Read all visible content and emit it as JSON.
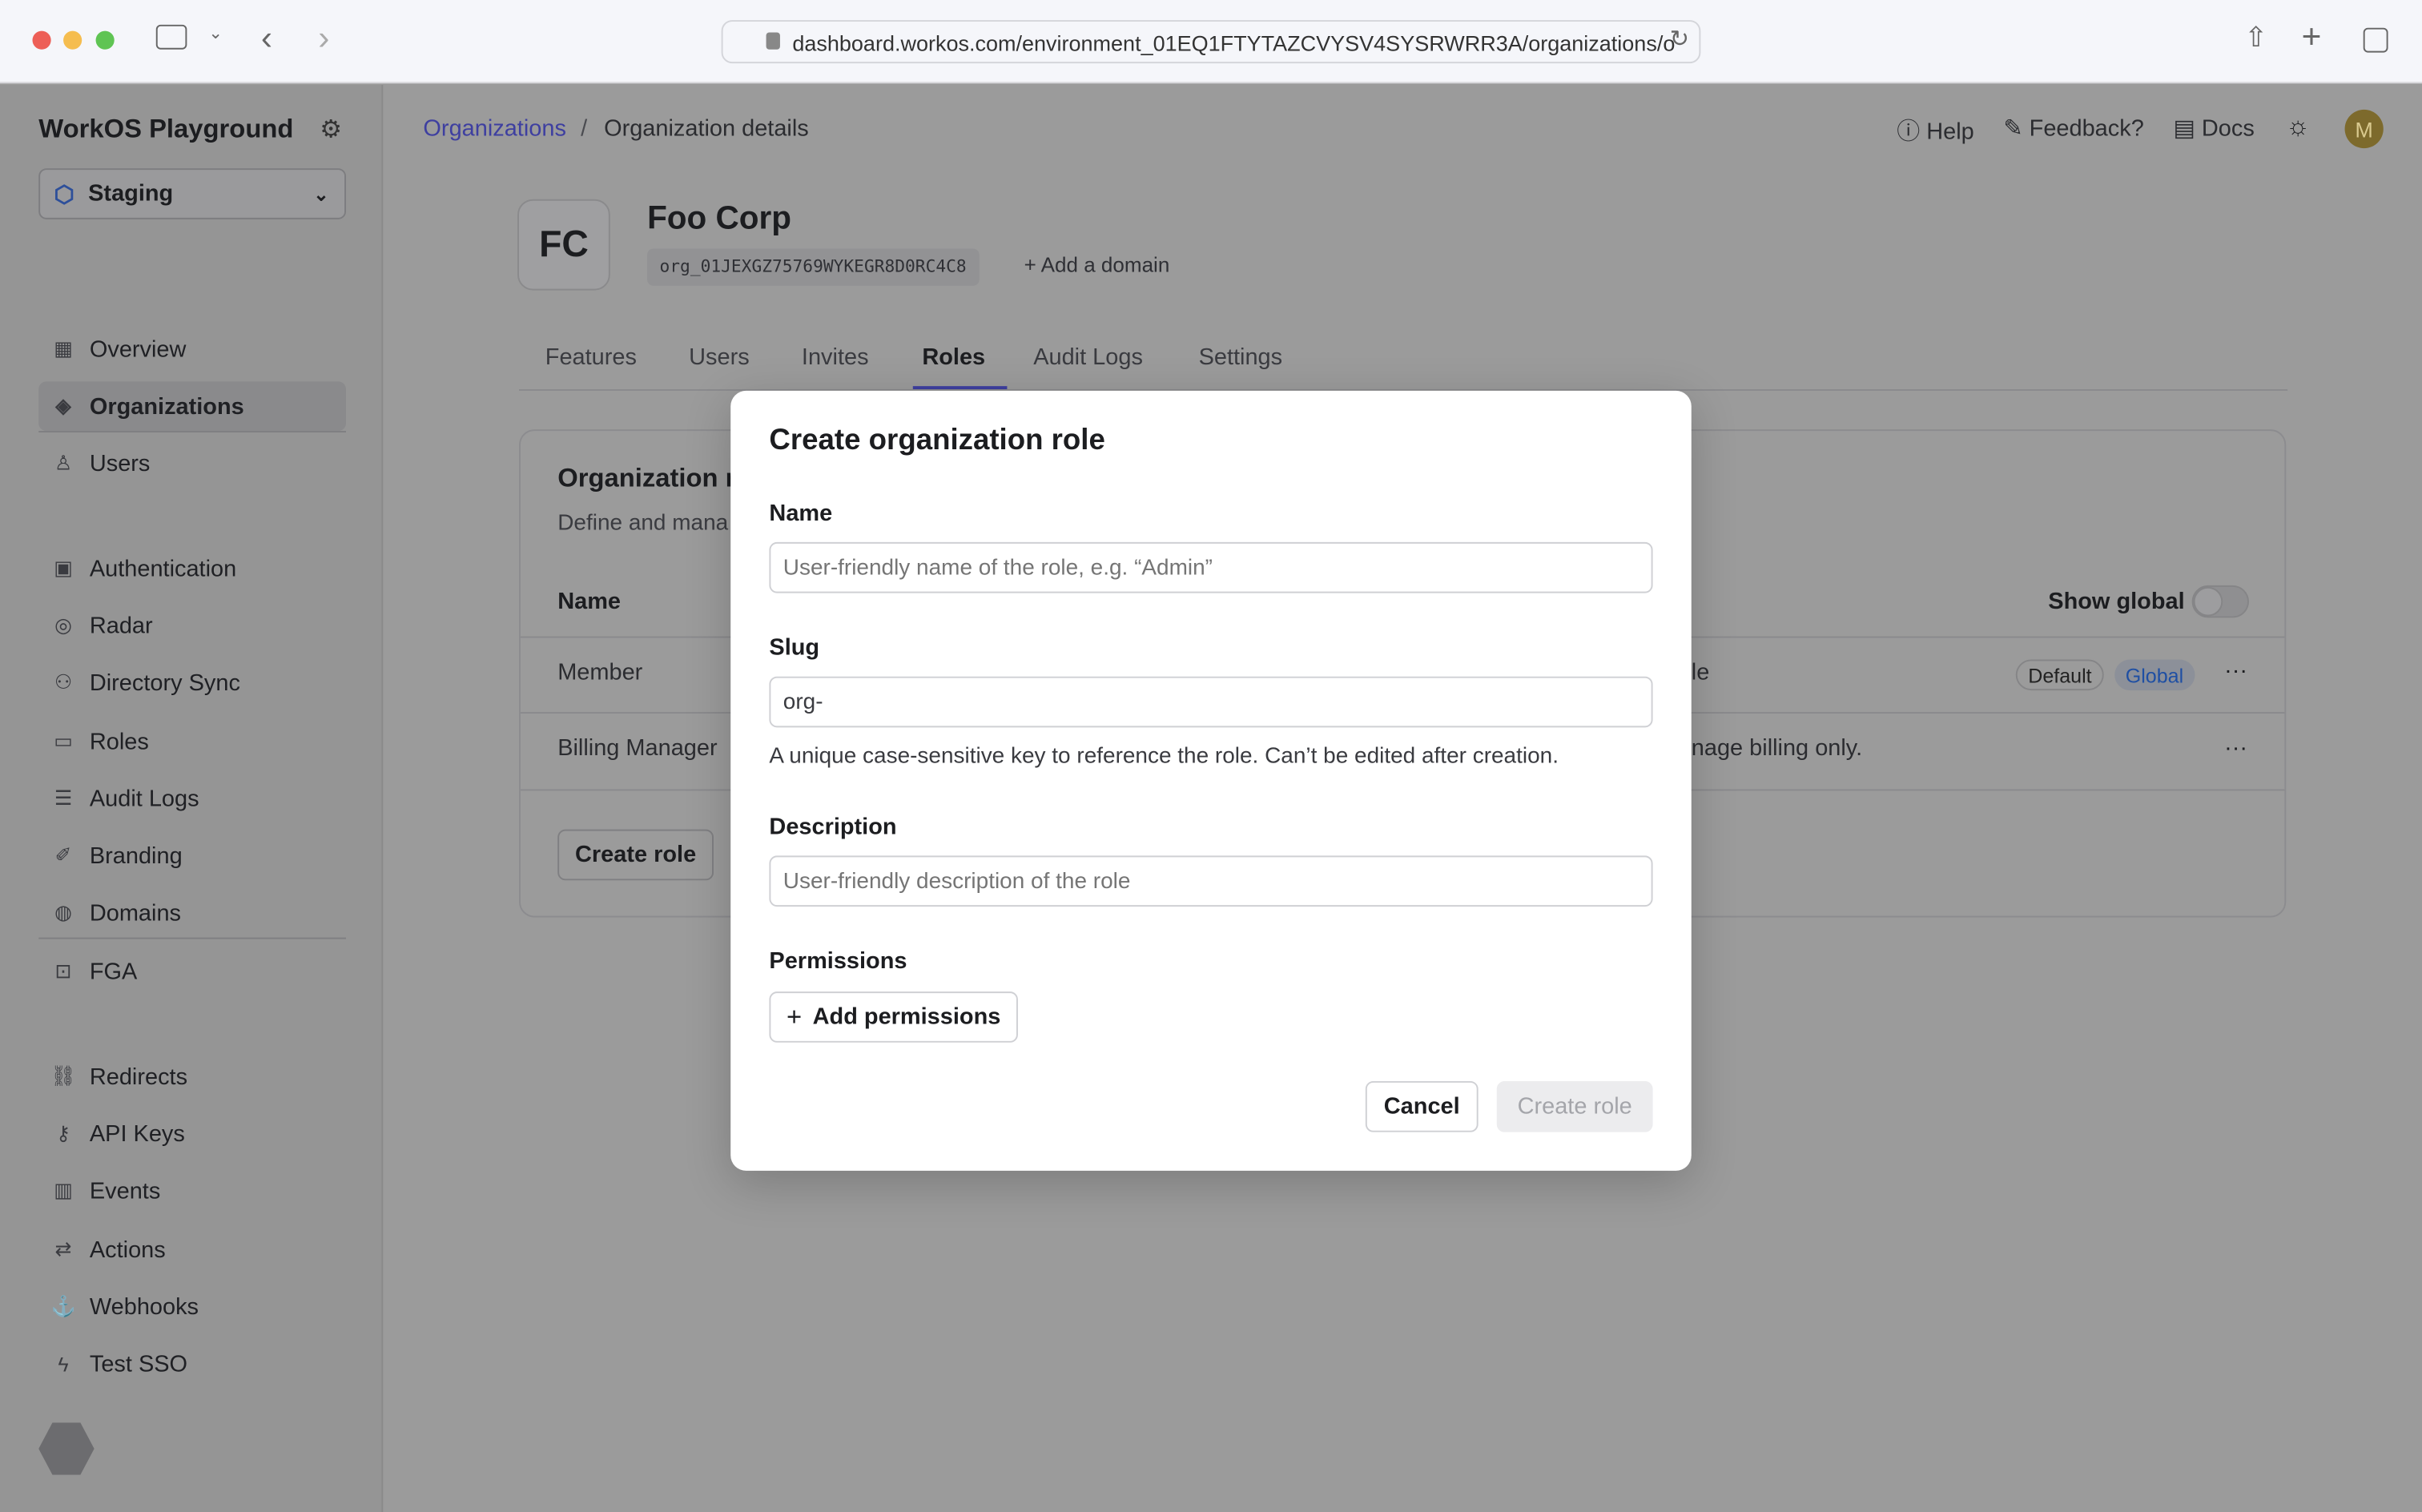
{
  "browser": {
    "url": "dashboard.workos.com/environment_01EQ1FTYTAZCVYSV4SYSRWRR3A/organizations/o"
  },
  "sidebar": {
    "app_title": "WorkOS Playground",
    "environment": "Staging",
    "items": [
      {
        "label": "Overview",
        "icon": "grid-icon"
      },
      {
        "label": "Organizations",
        "icon": "layers-icon"
      },
      {
        "label": "Users",
        "icon": "user-icon"
      },
      {
        "label": "Authentication",
        "icon": "auth-icon"
      },
      {
        "label": "Radar",
        "icon": "radar-icon"
      },
      {
        "label": "Directory Sync",
        "icon": "users-icon"
      },
      {
        "label": "Roles",
        "icon": "id-card-icon"
      },
      {
        "label": "Audit Logs",
        "icon": "audit-icon"
      },
      {
        "label": "Branding",
        "icon": "brush-icon"
      },
      {
        "label": "Domains",
        "icon": "globe-icon"
      },
      {
        "label": "FGA",
        "icon": "fga-icon"
      },
      {
        "label": "Redirects",
        "icon": "link-icon"
      },
      {
        "label": "API Keys",
        "icon": "key-icon"
      },
      {
        "label": "Events",
        "icon": "events-icon"
      },
      {
        "label": "Actions",
        "icon": "actions-icon"
      },
      {
        "label": "Webhooks",
        "icon": "webhook-icon"
      },
      {
        "label": "Test SSO",
        "icon": "bolt-icon"
      }
    ]
  },
  "header": {
    "breadcrumb_root": "Organizations",
    "breadcrumb_sep": "/",
    "breadcrumb_current": "Organization details",
    "help": "Help",
    "feedback": "Feedback?",
    "docs": "Docs",
    "avatar": "M"
  },
  "org": {
    "initials": "FC",
    "name": "Foo Corp",
    "id": "org_01JEXGZ75769WYKEGR8D0RC4C8",
    "add_domain": "Add a domain"
  },
  "tabs": [
    "Features",
    "Users",
    "Invites",
    "Roles",
    "Audit Logs",
    "Settings"
  ],
  "roles_card": {
    "title": "Organization r",
    "subtitle": "Define and mana",
    "col_name": "Name",
    "show_global": "Show global",
    "show_global_on": false,
    "rows": [
      {
        "name": "Member",
        "desc": "le",
        "badges": [
          "Default",
          "Global"
        ]
      },
      {
        "name": "Billing Manager",
        "desc": "nage billing only.",
        "badges": []
      }
    ],
    "create": "Create role"
  },
  "modal": {
    "title": "Create organization role",
    "name_label": "Name",
    "name_placeholder": "User-friendly name of the role, e.g. “Admin”",
    "slug_label": "Slug",
    "slug_value": "org-",
    "slug_help": "A unique case-sensitive key to reference the role. Can’t be edited after creation.",
    "desc_label": "Description",
    "desc_placeholder": "User-friendly description of the role",
    "perm_label": "Permissions",
    "add_perm": "Add permissions",
    "cancel": "Cancel",
    "create": "Create role"
  },
  "colors": {
    "accent": "#3e3fa0",
    "global_badge": "#1f4fa3"
  }
}
